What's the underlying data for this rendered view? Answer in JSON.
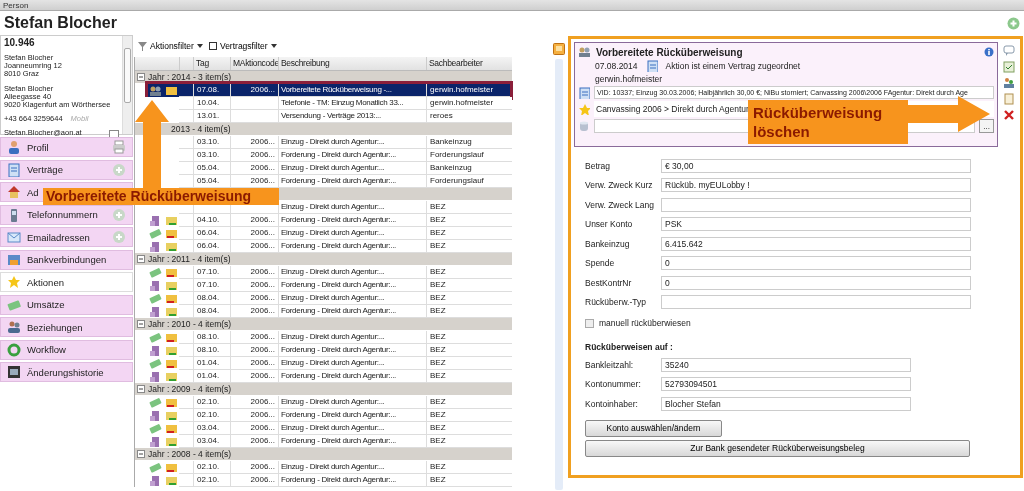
{
  "window": {
    "title": "Person"
  },
  "header": {
    "name": "Stefan Blocher"
  },
  "contact": {
    "number": "10.946",
    "addresses": [
      {
        "lines": [
          "Stefan Blocher",
          "Joanneumring 12",
          "8010 Graz"
        ]
      },
      {
        "lines": [
          "Stefan Blocher",
          "Alleegasse 40",
          "9020 Klagenfurt am Wörthersee"
        ]
      }
    ],
    "phone": "+43 664 3259644",
    "phone_type": "Mobil",
    "email": "Stefan.Blocher@aon.at"
  },
  "nav": [
    {
      "kind": "profile",
      "label": "Profil",
      "print_button": true,
      "selected": false
    },
    {
      "kind": "contracts",
      "label": "Verträge",
      "add_button": true,
      "selected": false
    },
    {
      "kind": "address",
      "label": "Ad",
      "selected": false
    },
    {
      "kind": "phone",
      "label": "Telefonnummern",
      "add_button": true,
      "selected": false
    },
    {
      "kind": "mail",
      "label": "Emailadressen",
      "add_button": true,
      "selected": false
    },
    {
      "kind": "bank",
      "label": "Bankverbindungen",
      "selected": false
    },
    {
      "kind": "actions",
      "label": "Aktionen",
      "selected": true
    },
    {
      "kind": "money",
      "label": "Umsätze",
      "selected": false
    },
    {
      "kind": "people",
      "label": "Beziehungen",
      "selected": false
    },
    {
      "kind": "workflow",
      "label": "Workflow",
      "selected": false
    },
    {
      "kind": "history",
      "label": "Änderungshistorie",
      "selected": false
    }
  ],
  "toolbar": {
    "filters": [
      {
        "kind": "funnel",
        "label": "Aktionsfilter"
      },
      {
        "kind": "checkbox",
        "label": "Vertragsfilter",
        "checked": false
      }
    ]
  },
  "table": {
    "columns": [
      "Tag",
      "MAktioncode",
      "Beschreibung",
      "Sachbearbeiter"
    ],
    "groups": [
      {
        "label": "Jahr : 2014 - 3 item(s)",
        "expanded": true,
        "rows": [
          {
            "kind": "prepared",
            "tag": "07.08.",
            "code": "2006...",
            "desc": "Vorbereitete Rücküberweisung -...",
            "clerk": "gerwin.hofmeister",
            "selected": true
          },
          {
            "tag": "10.04.",
            "desc": "Telefonie - TM: Einzug Monatlich 33...",
            "clerk": "gerwin.hofmeister",
            "selected": false
          },
          {
            "tag": "13.01.",
            "desc": "Versendung - Verträge 2013:...",
            "clerk": "reroes",
            "selected": false
          }
        ]
      },
      {
        "label": "2013 - 4 item(s)",
        "rows": [
          {
            "tag": "03.10.",
            "code": "2006...",
            "desc": "Einzug - Direkt durch Agentur:...",
            "clerk": "Bankeinzug",
            "selected": false
          },
          {
            "tag": "03.10.",
            "code": "2006...",
            "desc": "Forderung - Direkt durch Agentur:...",
            "clerk": "Forderungslauf",
            "selected": false
          },
          {
            "tag": "05.04.",
            "code": "2006...",
            "desc": "Einzug - Direkt durch Agentur:...",
            "clerk": "Bankeinzug",
            "selected": false
          },
          {
            "tag": "05.04.",
            "code": "2006...",
            "desc": "Forderung - Direkt durch Agentur:...",
            "clerk": "Forderungslauf",
            "selected": false
          }
        ]
      },
      {
        "rows": [
          {
            "desc": "Einzug - Direkt durch Agentur:...",
            "clerk": "BEZ",
            "selected": false
          },
          {
            "kind": "forderung",
            "tag": "04.10.",
            "code": "2006...",
            "desc": "Forderung - Direkt durch Agentur:...",
            "clerk": "BEZ",
            "selected": false
          },
          {
            "kind": "einzug",
            "tag": "06.04.",
            "code": "2006...",
            "desc": "Einzug - Direkt durch Agentur:...",
            "clerk": "BEZ",
            "selected": false
          },
          {
            "kind": "forderung",
            "tag": "06.04.",
            "code": "2006...",
            "desc": "Forderung - Direkt durch Agentur:...",
            "clerk": "BEZ",
            "selected": false
          }
        ]
      },
      {
        "label": "Jahr : 2011 - 4 item(s)",
        "expanded": true,
        "rows": [
          {
            "kind": "einzug",
            "tag": "07.10.",
            "code": "2006...",
            "desc": "Einzug - Direkt durch Agentur:...",
            "clerk": "BEZ",
            "selected": false
          },
          {
            "kind": "forderung",
            "tag": "07.10.",
            "code": "2006...",
            "desc": "Forderung - Direkt durch Agentur:...",
            "clerk": "BEZ",
            "selected": false
          },
          {
            "kind": "einzug",
            "tag": "08.04.",
            "code": "2006...",
            "desc": "Einzug - Direkt durch Agentur:...",
            "clerk": "BEZ",
            "selected": false
          },
          {
            "kind": "forderung",
            "tag": "08.04.",
            "code": "2006...",
            "desc": "Forderung - Direkt durch Agentur:...",
            "clerk": "BEZ",
            "selected": false
          }
        ]
      },
      {
        "label": "Jahr : 2010 - 4 item(s)",
        "expanded": true,
        "rows": [
          {
            "kind": "einzug",
            "tag": "08.10.",
            "code": "2006...",
            "desc": "Einzug - Direkt durch Agentur:...",
            "clerk": "BEZ",
            "selected": false
          },
          {
            "kind": "forderung",
            "tag": "08.10.",
            "code": "2006...",
            "desc": "Forderung - Direkt durch Agentur:...",
            "clerk": "BEZ",
            "selected": false
          },
          {
            "kind": "einzug",
            "tag": "01.04.",
            "code": "2006...",
            "desc": "Einzug - Direkt durch Agentur:...",
            "clerk": "BEZ",
            "selected": false
          },
          {
            "kind": "forderung",
            "tag": "01.04.",
            "code": "2006...",
            "desc": "Forderung - Direkt durch Agentur:...",
            "clerk": "BEZ",
            "selected": false
          }
        ]
      },
      {
        "label": "Jahr : 2009 - 4 item(s)",
        "expanded": true,
        "rows": [
          {
            "kind": "einzug",
            "tag": "02.10.",
            "code": "2006...",
            "desc": "Einzug - Direkt durch Agentur:...",
            "clerk": "BEZ",
            "selected": false
          },
          {
            "kind": "forderung",
            "tag": "02.10.",
            "code": "2006...",
            "desc": "Forderung - Direkt durch Agentur:...",
            "clerk": "BEZ",
            "selected": false
          },
          {
            "kind": "einzug",
            "tag": "03.04.",
            "code": "2006...",
            "desc": "Einzug - Direkt durch Agentur:...",
            "clerk": "BEZ",
            "selected": false
          },
          {
            "kind": "forderung",
            "tag": "03.04.",
            "code": "2006...",
            "desc": "Forderung - Direkt durch Agentur:...",
            "clerk": "BEZ",
            "selected": false
          }
        ]
      },
      {
        "label": "Jahr : 2008 - 4 item(s)",
        "expanded": true,
        "rows": [
          {
            "kind": "einzug",
            "tag": "02.10.",
            "code": "2006...",
            "desc": "Einzug - Direkt durch Agentur:...",
            "clerk": "BEZ",
            "selected": false
          },
          {
            "kind": "forderung",
            "tag": "02.10.",
            "code": "2006...",
            "desc": "Forderung - Direkt durch Agentur:...",
            "clerk": "BEZ",
            "selected": false
          }
        ]
      }
    ]
  },
  "detail": {
    "title": "Vorbereitete Rücküberweisung",
    "date": "07.08.2014",
    "note": "Aktion ist einem Vertrag zugeordnet",
    "clerk": "gerwin.hofmeister",
    "contract": "VID: 10337; Einzug 30.03.2006; Halbjährlich 30,00 €; NiBu storniert; Canvassing 2006\\2006 FAgentur: Direkt durch Age",
    "campaign": "Canvassing 2006  >  Direkt durch Agentur",
    "browse_button": "..."
  },
  "form": {
    "fields": [
      {
        "label": "Betrag",
        "value": "€ 30,00"
      },
      {
        "label": "Verw. Zweck Kurz",
        "value": "Rücküb. myEULobby !"
      },
      {
        "label": "Verw. Zweck Lang"
      },
      {
        "label": "Unser Konto",
        "value": "PSK"
      },
      {
        "label": "Bankeinzug",
        "value": "6.415.642"
      },
      {
        "label": "Spende",
        "value": "0"
      },
      {
        "label": "BestKontrNr",
        "value": "0"
      },
      {
        "label": "Rücküberw.-Typ"
      }
    ],
    "checkbox": {
      "label": "manuell rücküberwiesen",
      "checked": false
    },
    "section_title": "Rücküberweisen auf :",
    "bank_fields": [
      {
        "label": "Bankleitzahl:",
        "value": "35240"
      },
      {
        "label": "Kontonummer:",
        "value": "52793094501"
      },
      {
        "label": "Kontoinhaber:",
        "value": "Blocher Stefan"
      }
    ],
    "buttons": [
      "Konto auswählen/ändern",
      "Zur Bank gesendeter Rücküberweisungsbeleg"
    ]
  },
  "annotations": {
    "left_callout": "Vorbereitete Rücküberweisung",
    "right_callout": "Rücküberweisung löschen"
  }
}
